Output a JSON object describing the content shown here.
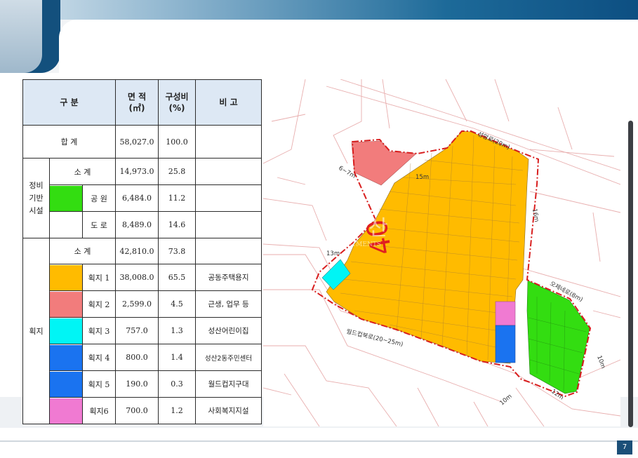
{
  "table": {
    "headers": {
      "category": "구 분",
      "area": "면 적\n(㎡)",
      "ratio": "구성비\n(%)",
      "remark": "비 고"
    },
    "total": {
      "label": "합 계",
      "area": "58,027.0",
      "ratio": "100.0",
      "remark": ""
    },
    "infrastructure": {
      "group_label": "정비\n기반\n시설",
      "subtotal": {
        "label": "소 계",
        "area": "14,973.0",
        "ratio": "25.8"
      },
      "rows": [
        {
          "label": "공 원",
          "area": "6,484.0",
          "ratio": "11.2",
          "remark": "",
          "color": "#33dd11"
        },
        {
          "label": "도 로",
          "area": "8,489.0",
          "ratio": "14.6",
          "remark": "",
          "color": "#ffffff"
        }
      ]
    },
    "lots": {
      "group_label": "획지",
      "subtotal": {
        "label": "소 계",
        "area": "42,810.0",
        "ratio": "73.8"
      },
      "rows": [
        {
          "label": "획지 1",
          "area": "38,008.0",
          "ratio": "65.5",
          "remark": "공동주택용지",
          "color": "#ffbb00"
        },
        {
          "label": "획지 2",
          "area": "2,599.0",
          "ratio": "4.5",
          "remark": "근생, 업무 등",
          "color": "#f27c7c"
        },
        {
          "label": "획지 3",
          "area": "757.0",
          "ratio": "1.3",
          "remark": "성산어린이집",
          "color": "#00f5f5"
        },
        {
          "label": "획지 4",
          "area": "800.0",
          "ratio": "1.4",
          "remark": "성산2동주민센터",
          "color": "#1a73f0"
        },
        {
          "label": "획지 5",
          "area": "190.0",
          "ratio": "0.3",
          "remark": "월드컵지구대",
          "color": "#1a73f0"
        },
        {
          "label": "획지6",
          "area": "700.0",
          "ratio": "1.2",
          "remark": "사회복지지설",
          "color": "#f07ad2"
        }
      ]
    }
  },
  "map": {
    "labels": {
      "road_seongam": "성암로(20m)",
      "road_worldcup": "월드컵북로(20~25m)",
      "road_ogye": "오제네로(8m)",
      "w_15m": "15m",
      "w_6_7m": "6~7m",
      "w_16m": "16m",
      "w_13m": "13m",
      "w_10m_a": "10m",
      "w_10m_b": "10m",
      "w_12m": "12m",
      "zone_mark": "40"
    },
    "watermark": {
      "main": "산",
      "sub": "STMENTS"
    },
    "colors": {
      "main_lot": "#ffbb00",
      "lot2": "#f27c7c",
      "lot3": "#00f5f5",
      "lot4": "#1a73f0",
      "lot6": "#f07ad2",
      "park": "#33dd11",
      "boundary": "#d81e1e"
    }
  },
  "footer": {
    "page_number": "7"
  }
}
